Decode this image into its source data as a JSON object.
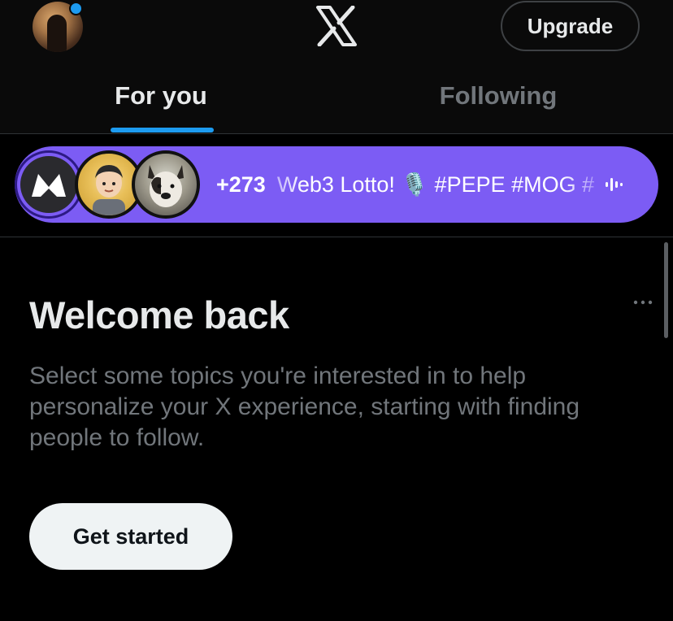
{
  "header": {
    "upgrade_label": "Upgrade",
    "tabs": [
      {
        "label": "For you",
        "selected": true
      },
      {
        "label": "Following",
        "selected": false
      }
    ],
    "logo_icon": "x-logo-icon",
    "accent_color": "#1d9bf0"
  },
  "space": {
    "listener_count": "+273",
    "title": "Web3 Lotto! 🎙️ #PEPE #MOG #",
    "background_color": "#7c5cf4",
    "icons": [
      "m-logo-avatar",
      "cartoon-person-avatar",
      "dog-avatar",
      "live-audio-icon"
    ]
  },
  "welcome": {
    "title": "Welcome back",
    "body": "Select some topics you're interested in to help personalize your X experience, starting with finding people to follow.",
    "button_label": "Get started",
    "menu_icon": "more-icon"
  }
}
